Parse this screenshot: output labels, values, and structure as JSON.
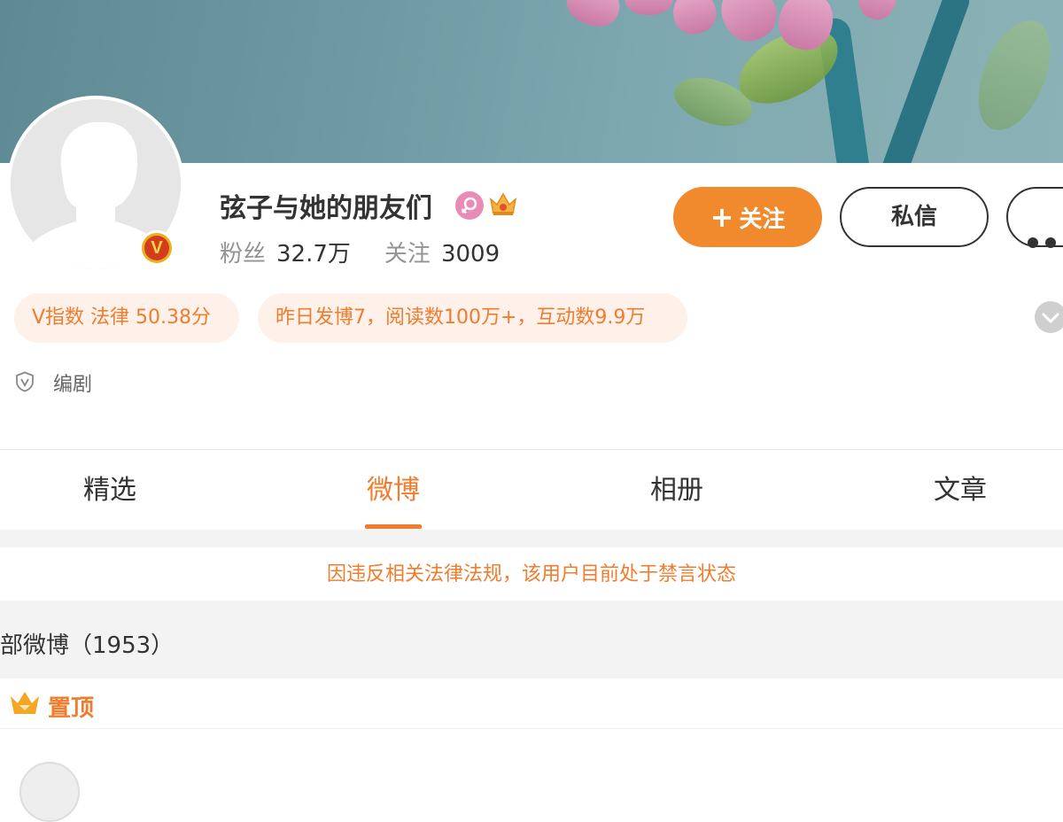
{
  "profile": {
    "name": "弦子与她的朋友们",
    "followers_label": "粉丝",
    "followers_value": "32.7万",
    "following_label": "关注",
    "following_value": "3009",
    "verified_badge": "V"
  },
  "actions": {
    "follow_plus": "+",
    "follow_label": "关注",
    "message_label": "私信"
  },
  "tags": {
    "v_index": "V指数 法律 50.38分",
    "activity": "昨日发博7，阅读数100万+，互动数9.9万"
  },
  "job": "编剧",
  "tabs": [
    "精选",
    "微博",
    "相册",
    "文章"
  ],
  "active_tab": "微博",
  "notice": "因违反相关法律法规，该用户目前处于禁言状态",
  "feed": {
    "all_count": "部微博（1953）",
    "pinned_label": "置顶"
  },
  "colors": {
    "accent": "#f07c2e",
    "follow_button": "#f08a2d",
    "tag_bg": "#fdf1ea"
  },
  "icons": [
    "female-icon",
    "crown-icon",
    "more-icon",
    "chevron-down-icon",
    "verified-shield-icon",
    "pin-crown-icon"
  ]
}
